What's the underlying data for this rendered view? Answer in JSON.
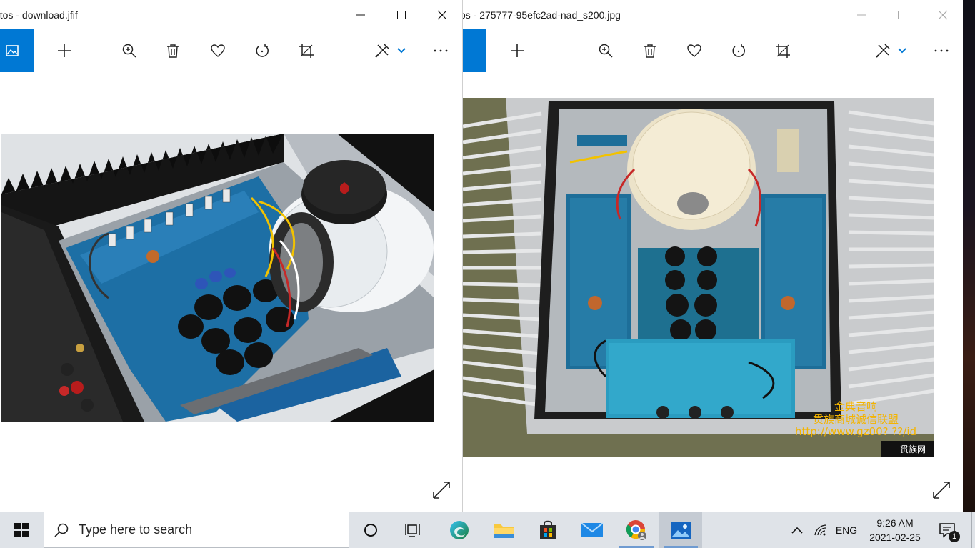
{
  "windows": [
    {
      "title": "otos - download.jfif",
      "active": true
    },
    {
      "title": "os - 275777-95efc2ad-nad_s200.jpg",
      "active": false,
      "watermark": {
        "line1": "金典音响",
        "line2": "贯族商城诚信联盟",
        "url": "http://www.gz00? ??/id",
        "logo": "贯族网"
      }
    }
  ],
  "toolbar_icons": [
    "add-icon",
    "zoom-in-icon",
    "delete-icon",
    "favorite-icon",
    "rotate-icon",
    "crop-icon",
    "edit-draw-icon",
    "more-icon"
  ],
  "taskbar": {
    "search_placeholder": "Type here to search",
    "language": "ENG",
    "time": "9:26 AM",
    "date": "2021-02-25",
    "notification_count": "1"
  },
  "colors": {
    "accent": "#0078d4",
    "taskbar": "#dfe3e8",
    "pcb_blue": "#1d6fa5"
  }
}
